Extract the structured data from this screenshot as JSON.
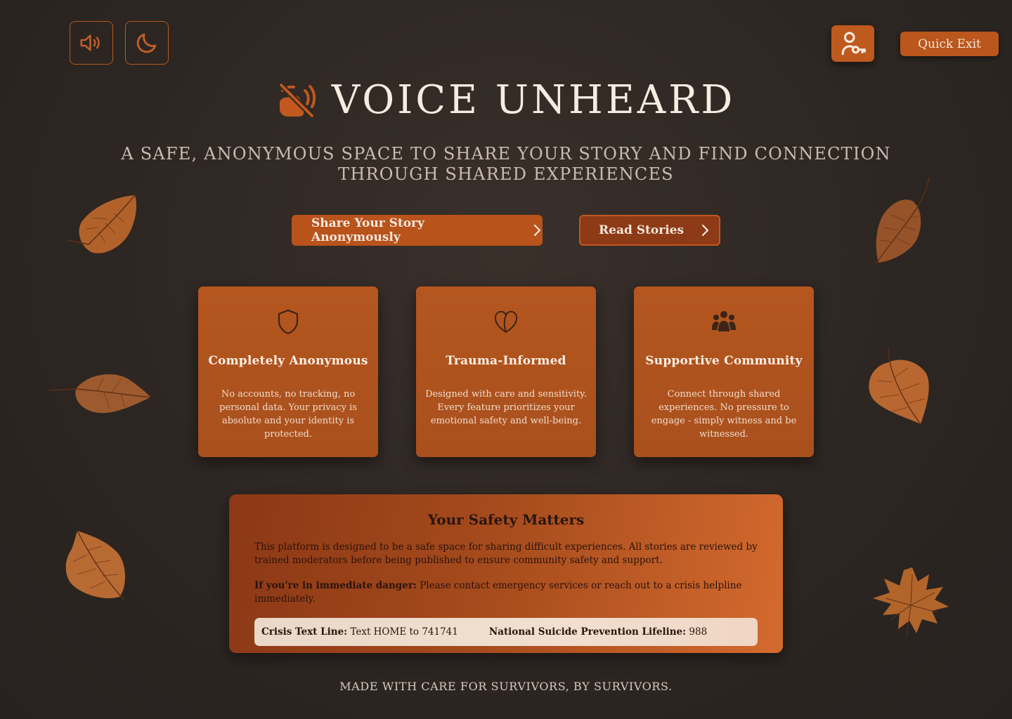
{
  "header": {
    "sound_icon": "speaker-icon",
    "theme_icon": "moon-icon",
    "accessibility_icon": "user-key-icon",
    "quick_exit_label": "Quick Exit"
  },
  "hero": {
    "logo_icon": "muted-speaker-icon",
    "title": "VOICE UNHEARD",
    "tagline": "A SAFE, ANONYMOUS SPACE TO SHARE YOUR STORY AND FIND CONNECTION THROUGH SHARED EXPERIENCES",
    "share_label": "Share Your Story Anonymously",
    "read_label": "Read Stories"
  },
  "features": [
    {
      "icon": "shield-icon",
      "title": "Completely Anonymous",
      "description": "No accounts, no tracking, no personal data. Your privacy is absolute and your identity is protected."
    },
    {
      "icon": "heart-icon",
      "title": "Trauma-Informed",
      "description": "Designed with care and sensitivity. Every feature prioritizes your emotional safety and well-being."
    },
    {
      "icon": "people-group-icon",
      "title": "Supportive Community",
      "description": "Connect through shared experiences. No pressure to engage - simply witness and be witnessed."
    }
  ],
  "safety": {
    "title": "Your Safety Matters",
    "body": "This platform is designed to be a safe space for sharing difficult experiences. All stories are reviewed by trained moderators before being published to ensure community safety and support.",
    "danger_label": "If you're in immediate danger:",
    "danger_text": " Please contact emergency services or reach out to a crisis helpline immediately.",
    "hotlines": [
      {
        "label": "Crisis Text Line:",
        "value": " Text HOME to 741741"
      },
      {
        "label": "National Suicide Prevention Lifeline:",
        "value": " 988"
      }
    ]
  },
  "footer": {
    "text": "MADE WITH CARE FOR SURVIVORS, BY SURVIVORS."
  },
  "colors": {
    "background": "#2d2622",
    "accent": "#b8531c",
    "accent_dark": "#8d3a16",
    "text_light": "#f7ece2"
  }
}
